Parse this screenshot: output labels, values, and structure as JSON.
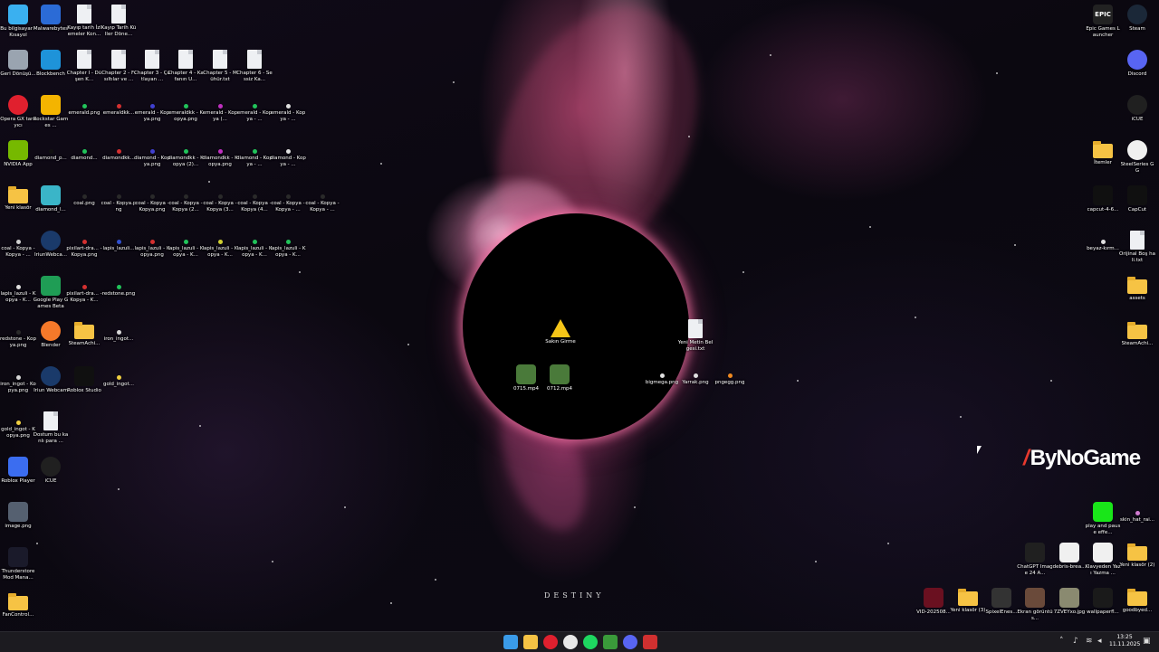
{
  "desktop": {
    "left_icons": [
      {
        "label": "Bu bilgisayar - Kısayol",
        "icon": "computer-icon",
        "kind": "app",
        "color": "#3ab0f0"
      },
      {
        "label": "Malwarebytes",
        "icon": "malwarebytes-icon",
        "kind": "app",
        "color": "#2b6bd6"
      },
      {
        "label": "Kayıp tarih İzlemeler Kon...",
        "icon": "text-file-icon",
        "kind": "file",
        "color": ""
      },
      {
        "label": "Kayıp Tarih Küller Döne...",
        "icon": "text-file-icon",
        "kind": "file",
        "color": ""
      },
      {
        "label": "Geri Dönüşü...",
        "icon": "recycle-bin-icon",
        "kind": "app",
        "color": "#9aa4b0"
      },
      {
        "label": "Blockbench",
        "icon": "blockbench-icon",
        "kind": "app",
        "color": "#1e93d9"
      },
      {
        "label": "Chapter I - Düşen K...",
        "icon": "text-file-icon",
        "kind": "file",
        "color": ""
      },
      {
        "label": "Chapter 2 - Fısıltılar ve ...",
        "icon": "text-file-icon",
        "kind": "file",
        "color": ""
      },
      {
        "label": "Chapter 3 - Çatlayan ...",
        "icon": "text-file-icon",
        "kind": "file",
        "color": ""
      },
      {
        "label": "Chapter 4 - Kafanın U...",
        "icon": "text-file-icon",
        "kind": "file",
        "color": ""
      },
      {
        "label": "Chapter 5 - Mühür.txt",
        "icon": "text-file-icon",
        "kind": "file",
        "color": ""
      },
      {
        "label": "Chapter 6 - Sessiz Ka...",
        "icon": "text-file-icon",
        "kind": "file",
        "color": ""
      },
      {
        "label": "Opera GX tarayıcı",
        "icon": "opera-gx-icon",
        "kind": "circle",
        "color": "#e0202e"
      },
      {
        "label": "Rockstar Games ...",
        "icon": "rockstar-icon",
        "kind": "app",
        "color": "#f4b400"
      },
      {
        "label": "emerald.png",
        "icon": "emerald-icon",
        "kind": "gem",
        "color": "#21c45a"
      },
      {
        "label": "emeraldkk...",
        "icon": "emerald-icon",
        "kind": "gem",
        "color": "#d43030"
      },
      {
        "label": "emerald - Kopya.png",
        "icon": "emerald-icon",
        "kind": "gem",
        "color": "#4040d0"
      },
      {
        "label": "emeraldkk - Kopya.png",
        "icon": "emerald-icon",
        "kind": "gem",
        "color": "#21c45a"
      },
      {
        "label": "emerald - Kopya (...",
        "icon": "emerald-icon",
        "kind": "gem",
        "color": "#c030c0"
      },
      {
        "label": "emerald - Kopya - ...",
        "icon": "emerald-icon",
        "kind": "gem",
        "color": "#21c45a"
      },
      {
        "label": "emerald - Kopya - ...",
        "icon": "emerald-icon",
        "kind": "gem",
        "color": "#e0e0e0"
      },
      {
        "label": "NVIDIA App",
        "icon": "nvidia-icon",
        "kind": "app",
        "color": "#76b900"
      },
      {
        "label": "diamond_p...",
        "icon": "diamond-icon",
        "kind": "gem",
        "color": "#111111"
      },
      {
        "label": "diamond...",
        "icon": "diamond-icon",
        "kind": "gem",
        "color": "#21c45a"
      },
      {
        "label": "diamondkk...",
        "icon": "diamond-icon",
        "kind": "gem",
        "color": "#d43030"
      },
      {
        "label": "diamond - Kopya.png",
        "icon": "diamond-icon",
        "kind": "gem",
        "color": "#4040d0"
      },
      {
        "label": "diamondkk - Kopya (2)...",
        "icon": "diamond-icon",
        "kind": "gem",
        "color": "#21c45a"
      },
      {
        "label": "diamondkk - Kopya.png",
        "icon": "diamond-icon",
        "kind": "gem",
        "color": "#c030c0"
      },
      {
        "label": "diamond - Kopya - ...",
        "icon": "diamond-icon",
        "kind": "gem",
        "color": "#21c45a"
      },
      {
        "label": "diamond - Kopya - ...",
        "icon": "diamond-icon",
        "kind": "gem",
        "color": "#e0e0e0"
      },
      {
        "label": "Yeni klasör",
        "icon": "folder-icon",
        "kind": "folder",
        "color": ""
      },
      {
        "label": "diamond_l...",
        "icon": "diamond-icon",
        "kind": "app",
        "color": "#3ab5c8"
      },
      {
        "label": "coal.png",
        "icon": "coal-icon",
        "kind": "gem",
        "color": "#2a2a2a"
      },
      {
        "label": "coal - Kopya.png",
        "icon": "coal-icon",
        "kind": "gem",
        "color": "#2a2a2a"
      },
      {
        "label": "coal - Kopya - Kopya.png",
        "icon": "coal-icon",
        "kind": "gem",
        "color": "#2a2a2a"
      },
      {
        "label": "coal - Kopya - Kopya (2...",
        "icon": "coal-icon",
        "kind": "gem",
        "color": "#2a2a2a"
      },
      {
        "label": "coal - Kopya - Kopya (3...",
        "icon": "coal-icon",
        "kind": "gem",
        "color": "#2a2a2a"
      },
      {
        "label": "coal - Kopya - Kopya (4...",
        "icon": "coal-icon",
        "kind": "gem",
        "color": "#2a2a2a"
      },
      {
        "label": "coal - Kopya - Kopya - ...",
        "icon": "coal-icon",
        "kind": "gem",
        "color": "#2a2a2a"
      },
      {
        "label": "coal - Kopya - Kopya - ...",
        "icon": "coal-icon",
        "kind": "gem",
        "color": "#2a2a2a"
      },
      {
        "label": "coal - Kopya - Kopya - ...",
        "icon": "coal-icon",
        "kind": "gem",
        "color": "#d0d0d0"
      },
      {
        "label": "IriunWebca...",
        "icon": "iriun-icon",
        "kind": "circle",
        "color": "#1a3a6a"
      },
      {
        "label": "pixilart-dra... - Kopya.png",
        "icon": "image-icon",
        "kind": "gem",
        "color": "#d43030"
      },
      {
        "label": "lapis_lazuli...",
        "icon": "lapis-icon",
        "kind": "gem",
        "color": "#3050d0"
      },
      {
        "label": "lapis_lazuli - Kopya.png",
        "icon": "lapis-icon",
        "kind": "gem",
        "color": "#d43030"
      },
      {
        "label": "lapis_lazuli - Kopya - K...",
        "icon": "lapis-icon",
        "kind": "gem",
        "color": "#21c45a"
      },
      {
        "label": "lapis_lazuli - Kopya - K...",
        "icon": "lapis-icon",
        "kind": "gem",
        "color": "#d0d030"
      },
      {
        "label": "lapis_lazuli - Kopya - K...",
        "icon": "lapis-icon",
        "kind": "gem",
        "color": "#21c45a"
      },
      {
        "label": "lapis_lazuli - Kopya - K...",
        "icon": "lapis-icon",
        "kind": "gem",
        "color": "#21c45a"
      },
      {
        "label": "lapis_lazuli - Kopya - K...",
        "icon": "lapis-icon",
        "kind": "gem",
        "color": "#e0e0e0"
      },
      {
        "label": "Google Play Games Beta",
        "icon": "google-play-icon",
        "kind": "app",
        "color": "#1f9d55"
      },
      {
        "label": "pixilart-dra... - Kopya - K...",
        "icon": "image-icon",
        "kind": "gem",
        "color": "#d43030"
      },
      {
        "label": "redstone.png",
        "icon": "redstone-icon",
        "kind": "gem",
        "color": "#21c45a"
      },
      {
        "label": "redstone - Kopya.png",
        "icon": "redstone-icon",
        "kind": "gem",
        "color": "#2a2a2a"
      },
      {
        "label": "Blender",
        "icon": "blender-icon",
        "kind": "circle",
        "color": "#f5792a"
      },
      {
        "label": "SteamAchi...",
        "icon": "folder-icon",
        "kind": "folder",
        "color": ""
      },
      {
        "label": "iron_ingot...",
        "icon": "iron-ingot-icon",
        "kind": "gem",
        "color": "#d8d8d8"
      },
      {
        "label": "iron_ingot - Kopya.png",
        "icon": "iron-ingot-icon",
        "kind": "gem",
        "color": "#d8d8d8"
      },
      {
        "label": "Iriun Webcam",
        "icon": "iriun-icon",
        "kind": "circle",
        "color": "#1a3a6a"
      },
      {
        "label": "Roblox Studio",
        "icon": "roblox-studio-icon",
        "kind": "app",
        "color": "#101010"
      },
      {
        "label": "gold_ingot...",
        "icon": "gold-ingot-icon",
        "kind": "gem",
        "color": "#f0d040"
      },
      {
        "label": "gold_ingot - Kopya.png",
        "icon": "gold-ingot-icon",
        "kind": "gem",
        "color": "#f0d040"
      },
      {
        "label": "Dostum bu kanlı para ...",
        "icon": "text-file-icon",
        "kind": "file",
        "color": ""
      },
      {
        "label": "Roblox Player",
        "icon": "roblox-icon",
        "kind": "app",
        "color": "#3b6df0"
      },
      {
        "label": "iCUE",
        "icon": "icue-icon",
        "kind": "circle",
        "color": "#202020"
      },
      {
        "label": "image.png",
        "icon": "image-icon",
        "kind": "app",
        "color": "#556070"
      },
      {
        "label": "Thunderstore Mod Mana...",
        "icon": "thunderstore-icon",
        "kind": "app",
        "color": "#1a1a2a"
      },
      {
        "label": "FanControl...",
        "icon": "folder-icon",
        "kind": "folder",
        "color": ""
      },
      {
        "label": "Ubisoft Connect",
        "icon": "ubisoft-icon",
        "kind": "circle",
        "color": "#2a2a40"
      }
    ],
    "center_icons": [
      {
        "label": "Sakın Girme",
        "icon": "warning-icon",
        "kind": "warning",
        "color": "#f5c518"
      },
      {
        "label": "Yeni Metin Belgesi.txt",
        "icon": "text-file-icon",
        "kind": "file",
        "color": ""
      },
      {
        "label": "0715.mp4",
        "icon": "video-icon",
        "kind": "app",
        "color": "#4a7a3a"
      },
      {
        "label": "0712.mp4",
        "icon": "video-icon",
        "kind": "app",
        "color": "#4a7a3a"
      },
      {
        "label": "bigmega.png",
        "icon": "image-icon",
        "kind": "gem",
        "color": "#e0e0e0"
      },
      {
        "label": "Yarrak.png",
        "icon": "image-icon",
        "kind": "gem",
        "color": "#e0e0e0"
      },
      {
        "label": "pngegg.png",
        "icon": "image-icon",
        "kind": "gem",
        "color": "#f08a20"
      }
    ],
    "right_icons": [
      {
        "label": "Epic Games Launcher",
        "icon": "epic-games-icon",
        "kind": "wrap",
        "color": "#222222",
        "glyph": "EPIC"
      },
      {
        "label": "Steam",
        "icon": "steam-icon",
        "kind": "circle",
        "color": "#1b2838"
      },
      {
        "label": "Discord",
        "icon": "discord-icon",
        "kind": "circle",
        "color": "#5865f2"
      },
      {
        "label": "iCUE",
        "icon": "icue-icon",
        "kind": "circle",
        "color": "#202020"
      },
      {
        "label": "İtemler",
        "icon": "folder-icon",
        "kind": "folder",
        "color": ""
      },
      {
        "label": "SteelSeries GG",
        "icon": "steelseries-icon",
        "kind": "circle",
        "color": "#f0f0f0"
      },
      {
        "label": "capcut-4-6...",
        "icon": "capcut-icon",
        "kind": "app",
        "color": "#101010"
      },
      {
        "label": "CapCut",
        "icon": "capcut-icon",
        "kind": "app",
        "color": "#101010"
      },
      {
        "label": "beyaz-kırm...",
        "icon": "image-icon",
        "kind": "gem",
        "color": "#e0e0e0"
      },
      {
        "label": "Orijinal Boş hali.txt",
        "icon": "text-file-icon",
        "kind": "file",
        "color": ""
      },
      {
        "label": "assets",
        "icon": "folder-icon",
        "kind": "folder",
        "color": ""
      },
      {
        "label": "SteamAchi...",
        "icon": "folder-icon",
        "kind": "folder",
        "color": ""
      },
      {
        "label": "play and pause effe...",
        "icon": "image-icon",
        "kind": "app",
        "color": "#19e619"
      },
      {
        "label": "skin_hat_rai...",
        "icon": "image-icon",
        "kind": "gem",
        "color": "#d07ad0"
      },
      {
        "label": "ChatGPT Image 24 A...",
        "icon": "image-icon",
        "kind": "app",
        "color": "#202020"
      },
      {
        "label": "debris-brea...",
        "icon": "video-icon",
        "kind": "app",
        "color": "#f0f0f0"
      },
      {
        "label": "Klavyeden Yazı Yazma ...",
        "icon": "video-icon",
        "kind": "app",
        "color": "#f0f0f0"
      },
      {
        "label": "Yeni klasör (2)",
        "icon": "folder-icon",
        "kind": "folder",
        "color": ""
      },
      {
        "label": "VID-202508...",
        "icon": "video-icon",
        "kind": "app",
        "color": "#6a1020"
      },
      {
        "label": "Yeni klasör (3)",
        "icon": "folder-icon",
        "kind": "folder",
        "color": ""
      },
      {
        "label": "SpixelEnes...",
        "icon": "image-icon",
        "kind": "app",
        "color": "#333333"
      },
      {
        "label": "Ekran görüntüs...",
        "icon": "image-icon",
        "kind": "app",
        "color": "#6a4a3a"
      },
      {
        "label": "7ZVEYxo.jpg",
        "icon": "image-icon",
        "kind": "app",
        "color": "#8a8a70"
      },
      {
        "label": "wallpaperfl...",
        "icon": "image-icon",
        "kind": "app",
        "color": "#1a1a1a"
      },
      {
        "label": "goodbyed...",
        "icon": "folder-icon",
        "kind": "folder",
        "color": ""
      }
    ],
    "wallpaper_brand": "DESTINY",
    "watermark": "ByNoGame"
  },
  "taskbar": {
    "items": [
      {
        "name": "start-button",
        "icon": "windows-icon",
        "color": "#3a9be8"
      },
      {
        "name": "file-explorer",
        "icon": "folder-icon",
        "color": "#f6c344"
      },
      {
        "name": "opera-gx",
        "icon": "opera-gx-icon",
        "color": "#e0202e"
      },
      {
        "name": "chrome",
        "icon": "chrome-icon",
        "color": "#e8e8e8"
      },
      {
        "name": "spotify",
        "icon": "spotify-icon",
        "color": "#1ed760"
      },
      {
        "name": "minecraft",
        "icon": "minecraft-icon",
        "color": "#3a9a3a"
      },
      {
        "name": "discord",
        "icon": "discord-icon",
        "color": "#5865f2"
      },
      {
        "name": "unknown-app",
        "icon": "app-icon",
        "color": "#d03030"
      }
    ],
    "tray": {
      "time": "13:25",
      "date": "11.11.2025"
    }
  }
}
